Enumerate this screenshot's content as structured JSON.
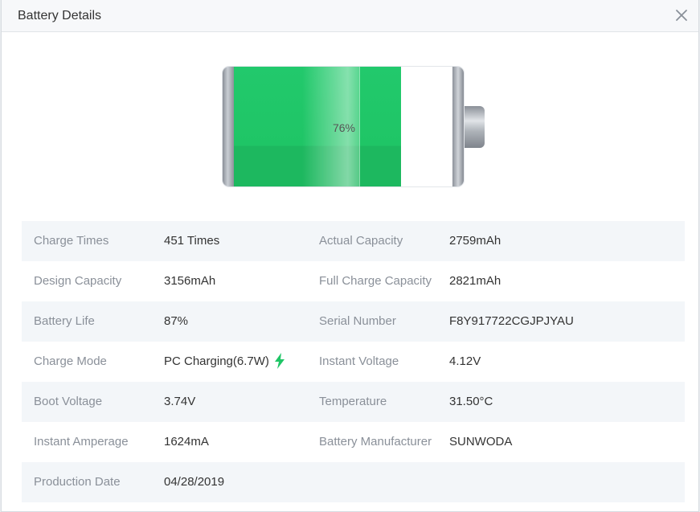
{
  "dialog": {
    "title": "Battery Details"
  },
  "battery": {
    "percent": 76,
    "percent_label": "76%",
    "fill_color": "#1fc566"
  },
  "details": [
    [
      {
        "label": "Charge Times",
        "value": "451 Times"
      },
      {
        "label": "Actual Capacity",
        "value": "2759mAh"
      }
    ],
    [
      {
        "label": "Design Capacity",
        "value": "3156mAh"
      },
      {
        "label": "Full Charge Capacity",
        "value": "2821mAh"
      }
    ],
    [
      {
        "label": "Battery Life",
        "value": "87%"
      },
      {
        "label": "Serial Number",
        "value": "F8Y917722CGJPJYAU"
      }
    ],
    [
      {
        "label": "Charge Mode",
        "value": "PC Charging(6.7W)",
        "icon": "lightning-bolt-icon"
      },
      {
        "label": "Instant Voltage",
        "value": "4.12V"
      }
    ],
    [
      {
        "label": "Boot Voltage",
        "value": "3.74V"
      },
      {
        "label": "Temperature",
        "value": "31.50°C"
      }
    ],
    [
      {
        "label": "Instant Amperage",
        "value": "1624mA"
      },
      {
        "label": "Battery Manufacturer",
        "value": "SUNWODA"
      }
    ],
    [
      {
        "label": "Production Date",
        "value": "04/28/2019"
      }
    ]
  ],
  "colors": {
    "accent_green": "#1fc566",
    "row_alt_bg": "#f3f6f9",
    "label_text": "#8a9099"
  }
}
